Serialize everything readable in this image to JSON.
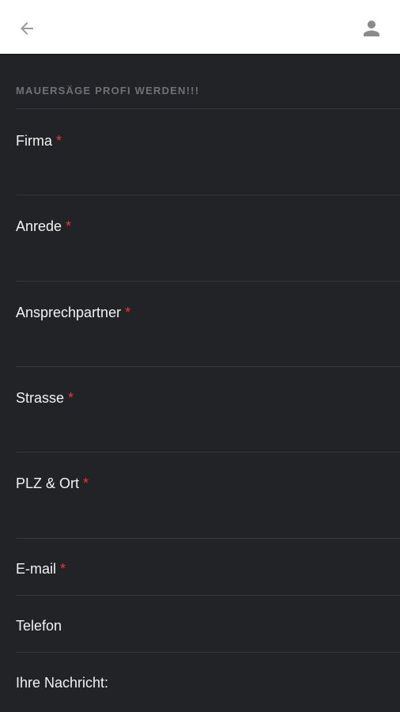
{
  "header": {
    "back_icon": "arrow-left-icon",
    "user_icon": "person-icon"
  },
  "section": {
    "title": "MAUERSÄGE PROFI WERDEN!!!"
  },
  "fields": [
    {
      "label": "Firma",
      "required": "*"
    },
    {
      "label": "Anrede",
      "required": "*"
    },
    {
      "label": "Ansprechpartner",
      "required": "*"
    },
    {
      "label": "Strasse",
      "required": "*"
    },
    {
      "label": "PLZ & Ort",
      "required": "*"
    },
    {
      "label": "E-mail",
      "required": "*"
    },
    {
      "label": "Telefon",
      "required": ""
    },
    {
      "label": "Ihre Nachricht:",
      "required": ""
    }
  ],
  "colors": {
    "background": "#222326",
    "topbar": "#ffffff",
    "required": "#e53935",
    "section_title": "#6f7177"
  }
}
